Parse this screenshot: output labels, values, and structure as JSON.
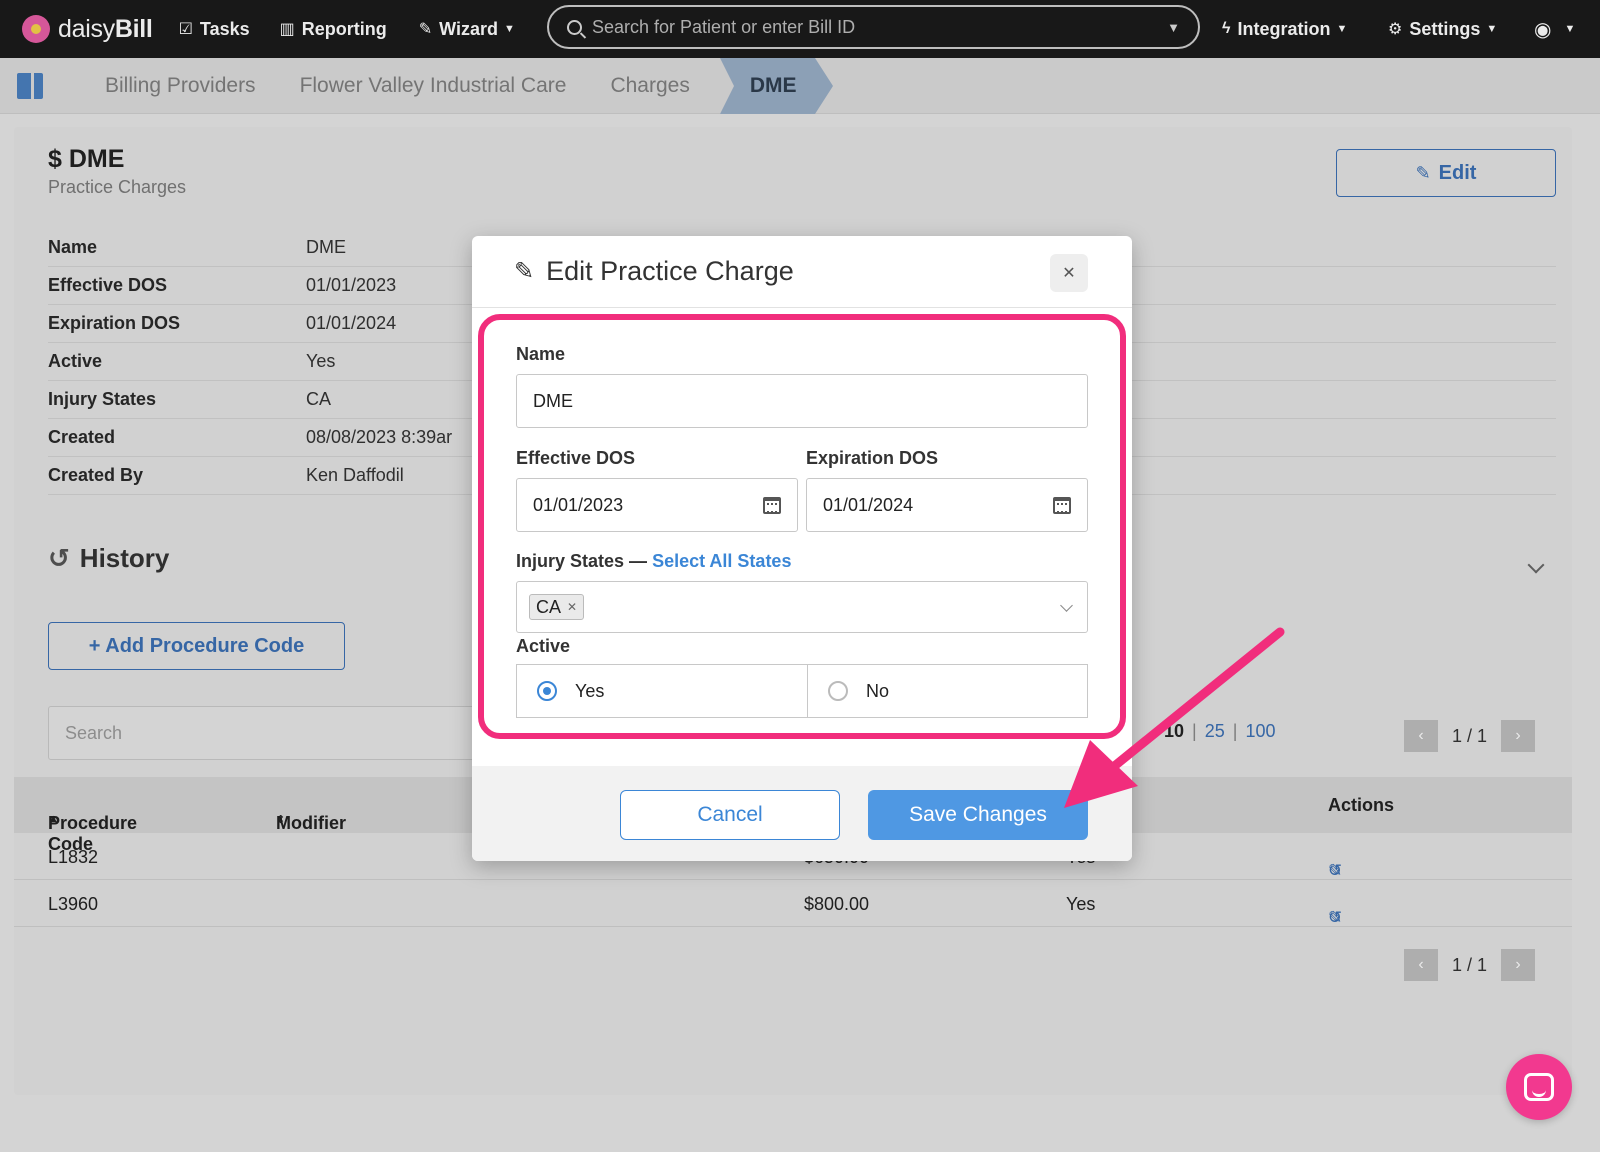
{
  "nav": {
    "brand_light": "daisy",
    "brand_bold": "Bill",
    "tasks": "Tasks",
    "reporting": "Reporting",
    "wizard": "Wizard",
    "search_placeholder": "Search for Patient or enter Bill ID",
    "integration": "Integration",
    "settings": "Settings"
  },
  "breadcrumb": [
    "Billing Providers",
    "Flower Valley Industrial Care",
    "Charges",
    "DME"
  ],
  "page": {
    "title": "$ DME",
    "subtitle": "Practice Charges",
    "edit_label": "Edit"
  },
  "details": [
    {
      "label": "Name",
      "value": "DME"
    },
    {
      "label": "Effective DOS",
      "value": "01/01/2023"
    },
    {
      "label": "Expiration DOS",
      "value": "01/01/2024"
    },
    {
      "label": "Active",
      "value": "Yes"
    },
    {
      "label": "Injury States",
      "value": "CA"
    },
    {
      "label": "Created",
      "value": "08/08/2023 8:39ar"
    },
    {
      "label": "Created By",
      "value": "Ken Daffodil"
    }
  ],
  "history_title": "History",
  "add_code_label": "+ Add Procedure Code",
  "table": {
    "search_placeholder": "Search",
    "page_sizes": [
      "10",
      "25",
      "100"
    ],
    "pager_text": "1 / 1",
    "headers": {
      "code": "Procedure Code",
      "modifier": "Modifier",
      "actions": "Actions"
    },
    "rows": [
      {
        "code": "L1832",
        "price": "$650.00",
        "active": "Yes"
      },
      {
        "code": "L3960",
        "price": "$800.00",
        "active": "Yes"
      }
    ]
  },
  "modal": {
    "title": "Edit Practice Charge",
    "name_label": "Name",
    "name_value": "DME",
    "effective_label": "Effective DOS",
    "effective_value": "01/01/2023",
    "expiration_label": "Expiration DOS",
    "expiration_value": "01/01/2024",
    "injury_label": "Injury States —",
    "select_all": "Select All States",
    "injury_tag": "CA",
    "active_label": "Active",
    "yes_label": "Yes",
    "no_label": "No",
    "cancel_label": "Cancel",
    "save_label": "Save Changes"
  },
  "colors": {
    "highlight": "#f12d7c",
    "accent": "#4f98e3",
    "nav_bg": "#1b1b1b"
  }
}
